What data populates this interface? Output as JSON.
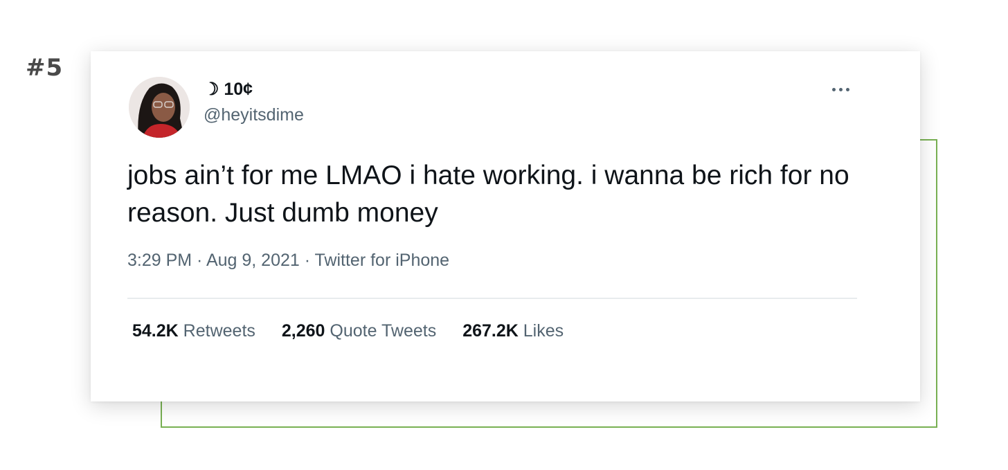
{
  "rank_label": "#5",
  "tweet": {
    "display_name": "☽ 10¢",
    "handle": "@heyitsdime",
    "text": "jobs ain’t for me LMAO i hate working. i wanna be rich for no reason. Just dumb money",
    "meta": "3:29 PM · Aug 9, 2021 · Twitter for iPhone",
    "stats": [
      {
        "value": "54.2K",
        "label": "Retweets"
      },
      {
        "value": "2,260",
        "label": "Quote Tweets"
      },
      {
        "value": "267.2K",
        "label": "Likes"
      }
    ]
  },
  "colors": {
    "frame_outline": "#78b052",
    "text_primary": "#0f1419",
    "text_secondary": "#536471",
    "rank_text": "#4a4a4a"
  },
  "icons": {
    "more": "more-horizontal-icon"
  }
}
